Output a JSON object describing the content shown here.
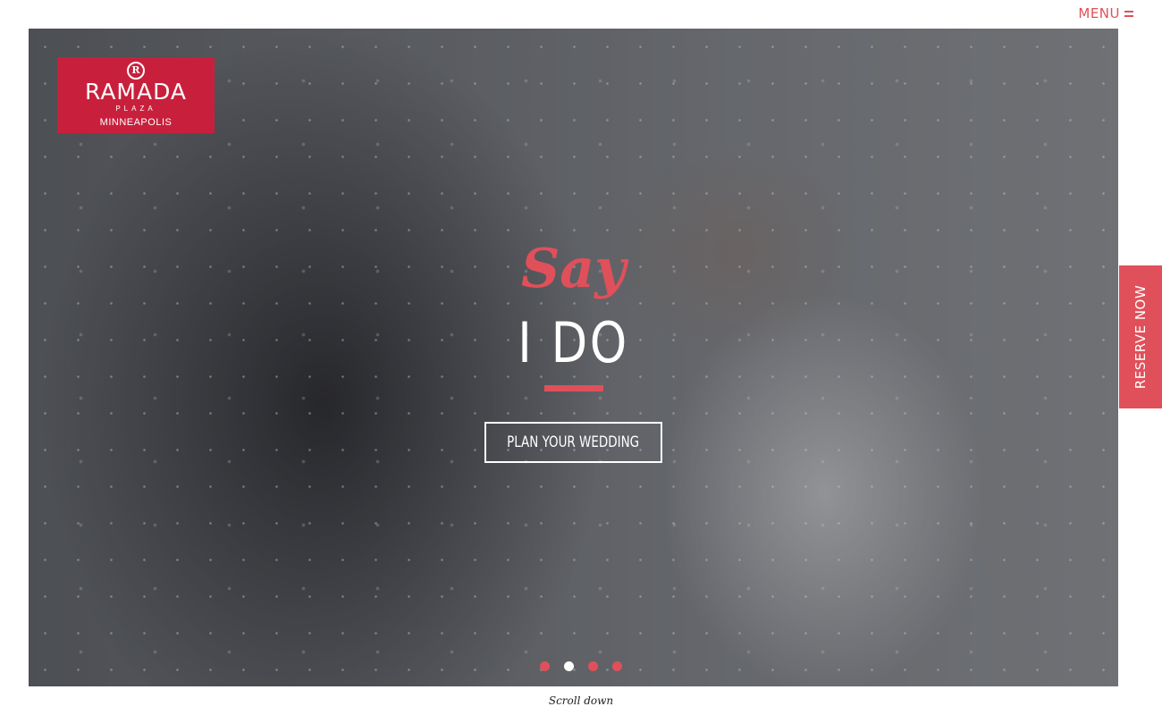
{
  "header": {
    "menu_label": "MENU",
    "menu_icon": "hamburger-icon"
  },
  "logo": {
    "mark": "R",
    "name": "RAMADA",
    "sub": "PLAZA",
    "city": "MINNEAPOLIS"
  },
  "hero": {
    "script_text": "Say",
    "headline": "I DO",
    "cta_label": "PLAN YOUR WEDDING",
    "slides": {
      "count": 4,
      "active_index": 1
    }
  },
  "reserve_label": "RESERVE NOW",
  "scroll_label": "Scroll down",
  "colors": {
    "accent": "#e0505a",
    "brand": "#c8203c",
    "text_light": "#ffffff"
  }
}
